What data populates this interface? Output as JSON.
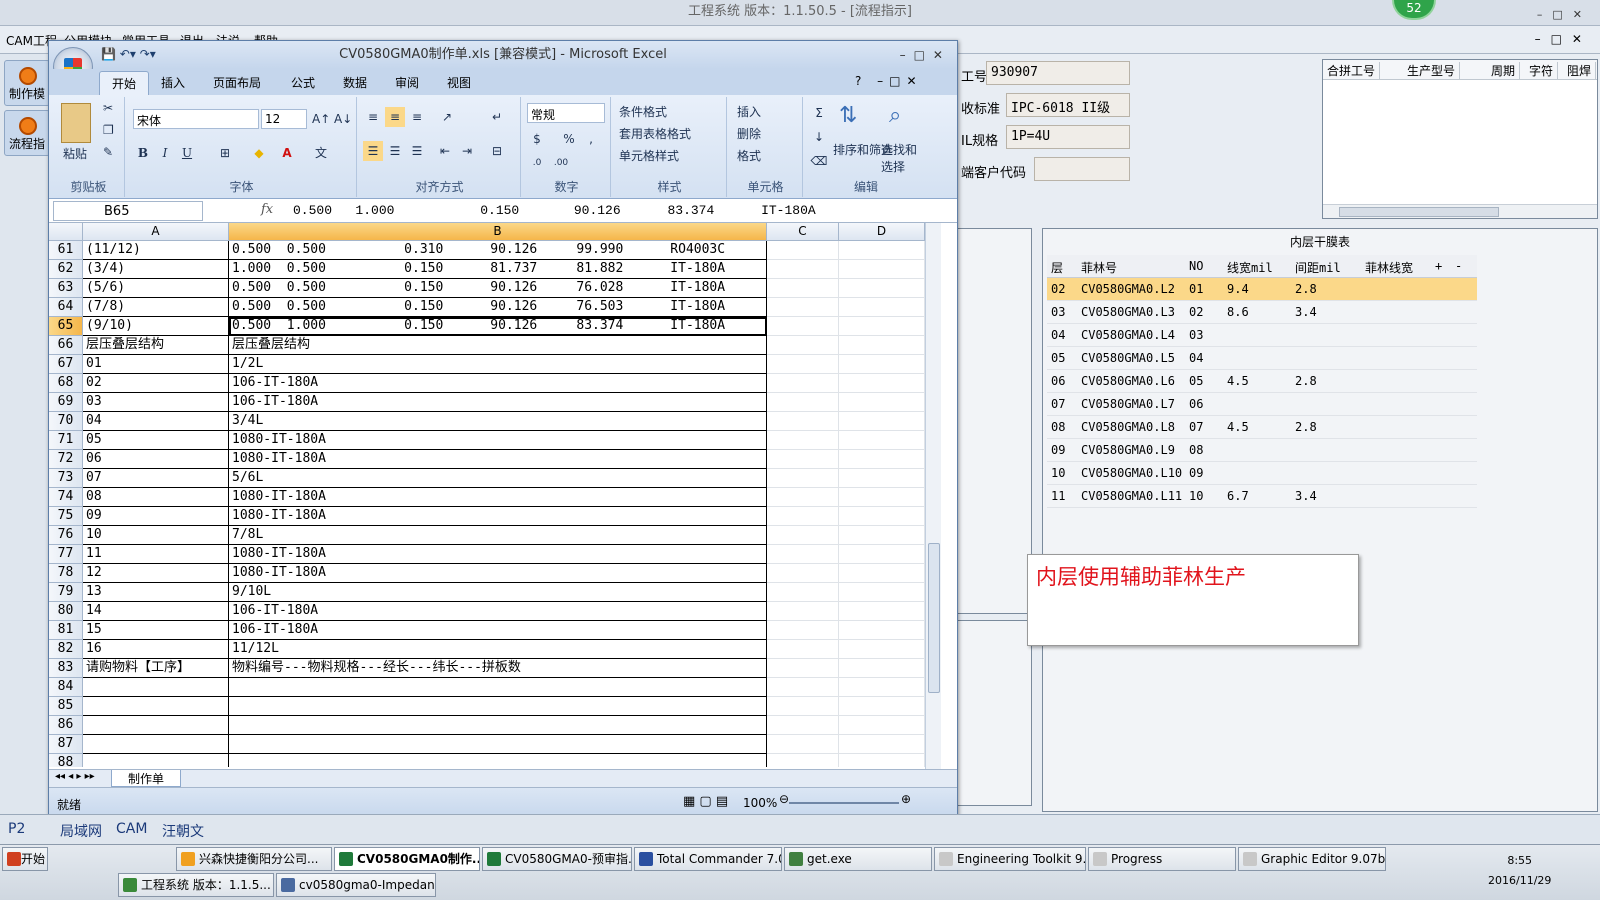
{
  "bg_window": {
    "title": "工程系统   版本：1.1.50.5 - [流程指示]",
    "menu": [
      "CAM工程",
      "公用模块",
      "常用工具",
      "退出",
      "法说",
      "帮助"
    ],
    "badge": "52"
  },
  "left_buttons": [
    "制作模",
    "流程指"
  ],
  "right_fields": [
    {
      "label": "工号",
      "value": "930907"
    },
    {
      "label": "收标准",
      "value": "IPC-6018 II级"
    },
    {
      "label": "IL规格",
      "value": "1P=4U"
    },
    {
      "label": "端客户代码",
      "value": ""
    }
  ],
  "merge_table": {
    "headers": [
      "合拼工号",
      "生产型号",
      "周期",
      "字符",
      "阻焊"
    ]
  },
  "inner_panel": {
    "title": "内层干膜表",
    "headers": [
      "层",
      "菲林号",
      "NO",
      "线宽mil",
      "间距mil",
      "菲林线宽",
      "+",
      "-"
    ],
    "rows": [
      [
        "02",
        "CV0580GMA0.L2",
        "01",
        "9.4",
        "2.8"
      ],
      [
        "03",
        "CV0580GMA0.L3",
        "02",
        "8.6",
        "3.4"
      ],
      [
        "04",
        "CV0580GMA0.L4",
        "03",
        "",
        ""
      ],
      [
        "05",
        "CV0580GMA0.L5",
        "04",
        "",
        ""
      ],
      [
        "06",
        "CV0580GMA0.L6",
        "05",
        "4.5",
        "2.8"
      ],
      [
        "07",
        "CV0580GMA0.L7",
        "06",
        "",
        ""
      ],
      [
        "08",
        "CV0580GMA0.L8",
        "07",
        "4.5",
        "2.8"
      ],
      [
        "09",
        "CV0580GMA0.L9",
        "08",
        "",
        ""
      ],
      [
        "10",
        "CV0580GMA0.L10",
        "09",
        "",
        ""
      ],
      [
        "11",
        "CV0580GMA0.L11",
        "10",
        "6.7",
        "3.4"
      ]
    ]
  },
  "note": "内层使用辅助菲林生产",
  "excel": {
    "title": "CV0580GMA0制作单.xls  [兼容模式] - Microsoft Excel",
    "tabs": [
      "开始",
      "插入",
      "页面布局",
      "公式",
      "数据",
      "审阅",
      "视图"
    ],
    "ribbon": {
      "clipboard": "剪贴板",
      "paste": "粘贴",
      "font_group": "字体",
      "font_name": "宋体",
      "font_size": "12",
      "align": "对齐方式",
      "number": "数字",
      "number_format": "常规",
      "styles": "样式",
      "cond_format": "条件格式",
      "table_format": "套用表格格式",
      "cell_style": "单元格样式",
      "cells": "单元格",
      "insert": "插入",
      "delete": "删除",
      "format": "格式",
      "edit": "编辑",
      "sort": "排序和筛选",
      "find": "查找和选择"
    },
    "name_box": "B65",
    "formula": "0.500   1.000           0.150       90.126      83.374      IT-180A",
    "columns": [
      "A",
      "B",
      "C",
      "D"
    ],
    "rows": [
      {
        "n": "61",
        "a": "(11/12)",
        "b": "0.500  0.500          0.310      90.126     99.990      RO4003C"
      },
      {
        "n": "62",
        "a": "(3/4)",
        "b": "1.000  0.500          0.150      81.737     81.882      IT-180A"
      },
      {
        "n": "63",
        "a": "(5/6)",
        "b": "0.500  0.500          0.150      90.126     76.028      IT-180A"
      },
      {
        "n": "64",
        "a": "(7/8)",
        "b": "0.500  0.500          0.150      90.126     76.503      IT-180A"
      },
      {
        "n": "65",
        "a": "(9/10)",
        "b": "0.500  1.000          0.150      90.126     83.374      IT-180A"
      },
      {
        "n": "66",
        "a": "层压叠层结构",
        "b": "层压叠层结构"
      },
      {
        "n": "67",
        "a": "01",
        "b": "1/2L"
      },
      {
        "n": "68",
        "a": "02",
        "b": "106-IT-180A"
      },
      {
        "n": "69",
        "a": "03",
        "b": "106-IT-180A"
      },
      {
        "n": "70",
        "a": "04",
        "b": "3/4L"
      },
      {
        "n": "71",
        "a": "05",
        "b": "1080-IT-180A"
      },
      {
        "n": "72",
        "a": "06",
        "b": "1080-IT-180A"
      },
      {
        "n": "73",
        "a": "07",
        "b": "5/6L"
      },
      {
        "n": "74",
        "a": "08",
        "b": "1080-IT-180A"
      },
      {
        "n": "75",
        "a": "09",
        "b": "1080-IT-180A"
      },
      {
        "n": "76",
        "a": "10",
        "b": "7/8L"
      },
      {
        "n": "77",
        "a": "11",
        "b": "1080-IT-180A"
      },
      {
        "n": "78",
        "a": "12",
        "b": "1080-IT-180A"
      },
      {
        "n": "79",
        "a": "13",
        "b": "9/10L"
      },
      {
        "n": "80",
        "a": "14",
        "b": "106-IT-180A"
      },
      {
        "n": "81",
        "a": "15",
        "b": "106-IT-180A"
      },
      {
        "n": "82",
        "a": "16",
        "b": "11/12L"
      },
      {
        "n": "83",
        "a": "请购物料【工序】",
        "b": "物料编号---物料规格---经长---纬长---拼板数"
      },
      {
        "n": "84",
        "a": "",
        "b": ""
      },
      {
        "n": "85",
        "a": "",
        "b": ""
      },
      {
        "n": "86",
        "a": "",
        "b": ""
      },
      {
        "n": "87",
        "a": "",
        "b": ""
      },
      {
        "n": "88",
        "a": "",
        "b": ""
      }
    ],
    "sheet_tab": "制作单",
    "status": "就绪",
    "zoom": "100%"
  },
  "bottom_bar": [
    "P2",
    "局域网",
    "CAM",
    "汪朝文"
  ],
  "taskbar": {
    "start": "开始",
    "items": [
      "兴森快捷衡阳分公司...",
      "CV0580GMA0制作...",
      "CV0580GMA0-预审指...",
      "Total Commander 7.0 ...",
      "get.exe",
      "Engineering Toolkit 9.0...",
      "Progress",
      "Graphic Editor 9.07b2 ...",
      "工程系统  版本：1.1.5...",
      "cv0580gma0-Impedance..."
    ],
    "time": "8:55",
    "date": "2016/11/29"
  }
}
